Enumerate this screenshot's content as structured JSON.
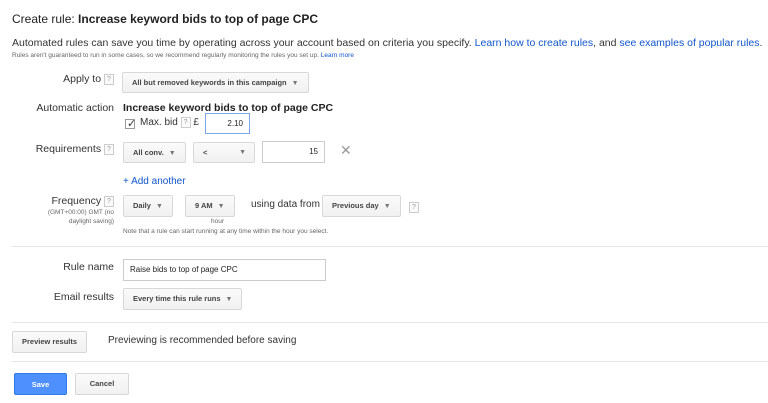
{
  "header": {
    "title_prefix": "Create rule:",
    "title_name": "Increase keyword bids to top of page CPC",
    "description": "Automated rules can save you time by operating across your account based on criteria you specify.",
    "link_how": "Learn how to create rules",
    "desc_and": ", and",
    "link_examples": "see examples of popular rules",
    "desc_end": ".",
    "note": "Rules aren't guaranteed to run in some cases, so we recommend regularly monitoring the rules you set up.",
    "note_link": "Learn more"
  },
  "apply_to": {
    "label": "Apply to",
    "help": "?",
    "value": "All but removed keywords in this campaign"
  },
  "action": {
    "label": "Automatic action",
    "value": "Increase keyword bids to top of page CPC",
    "max_bid_label": "Max. bid",
    "max_bid_help": "?",
    "currency": "£",
    "max_bid_value": "2.10"
  },
  "requirements": {
    "label": "Requirements",
    "help": "?",
    "metric": "All conv.",
    "operator": "<",
    "value": "15",
    "add_another": "+ Add another"
  },
  "frequency": {
    "label": "Frequency",
    "help": "?",
    "tz1": "(GMT+00:00) GMT (no",
    "tz2": "daylight saving)",
    "period": "Daily",
    "time": "9 AM",
    "hour_caption": "hour",
    "using_data": "using data from",
    "data_range": "Previous day",
    "data_help": "?",
    "note": "Note that a rule can start running at any time within the hour you select."
  },
  "rule_name": {
    "label": "Rule name",
    "value": "Raise bids to top of page CPC"
  },
  "email": {
    "label": "Email results",
    "value": "Every time this rule runs"
  },
  "preview": {
    "button": "Preview results",
    "message": "Previewing is recommended before saving"
  },
  "footer": {
    "save": "Save",
    "cancel": "Cancel"
  }
}
